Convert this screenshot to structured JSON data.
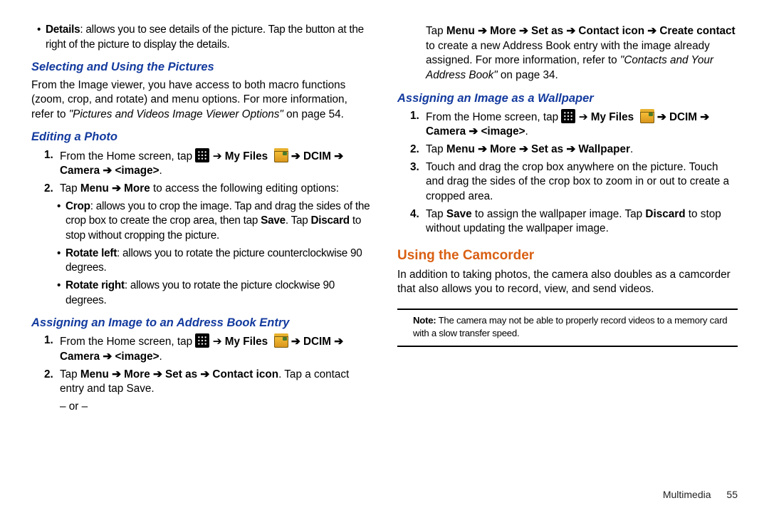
{
  "left": {
    "details_bullet": {
      "title": "Details",
      "text": ": allows you to see details of the picture. Tap the button at the right of the picture to display the details."
    },
    "selecting_head": "Selecting and Using the Pictures",
    "selecting_para_a": "From the Image viewer, you have access to both macro functions (zoom, crop, and rotate) and menu options. For more information, refer to ",
    "selecting_para_ref": "\"Pictures and Videos Image Viewer Options\"",
    "selecting_para_b": "  on page 54.",
    "editing_head": "Editing a Photo",
    "edit_step1_a": "From the Home screen, tap ",
    "edit_step1_b": " ➔ ",
    "edit_step1_myfiles": "My Files",
    "edit_step1_dcim": " ➔  DCIM ➔ Camera ➔ <image>",
    "edit_step1_dot": ".",
    "edit_step2_a": "Tap ",
    "edit_step2_b": "Menu ➔ More",
    "edit_step2_c": " to access the following editing options:",
    "crop_title": "Crop",
    "crop_text": ": allows you to crop the image. Tap and drag the sides of the crop box to create the crop area, then tap ",
    "crop_save": "Save",
    "crop_mid": ". Tap ",
    "crop_discard": "Discard",
    "crop_end": " to stop without cropping the picture.",
    "rotl_title": "Rotate left",
    "rotl_text": ": allows you to rotate the picture counterclockwise 90 degrees.",
    "rotr_title": "Rotate right",
    "rotr_text": ": allows you to rotate the picture clockwise 90 degrees.",
    "assign_ab_head": "Assigning an Image to an Address Book Entry",
    "ab_step1_a": "From the Home screen, tap ",
    "ab_step1_myfiles": "My Files",
    "ab_step1_dcim": " ➔  DCIM ➔ Camera ➔ <image>",
    "ab_step1_dot": ".",
    "ab_step2_a": "Tap ",
    "ab_step2_b": "Menu ➔ More ➔ Set as ➔ Contact icon",
    "ab_step2_c": ". Tap a contact entry and tap Save.",
    "or_text": "– or –"
  },
  "right": {
    "top_a": "Tap ",
    "top_b": "Menu ➔ More ➔ Set as ➔ Contact icon ➔ Create contact",
    "top_c": " to create a new Address Book entry with the image already assigned. For more information, refer to ",
    "top_ref": "\"Contacts and Your Address Book\"",
    "top_d": "  on page 34.",
    "wall_head": "Assigning an Image as a Wallpaper",
    "w_step1_a": "From the Home screen, tap ",
    "w_step1_myfiles": "My Files",
    "w_step1_dcim": " ➔  DCIM ➔ Camera ➔ <image>",
    "w_step1_dot": ".",
    "w_step2_a": "Tap ",
    "w_step2_b": "Menu ➔ More ➔ Set as ➔ Wallpaper",
    "w_step2_dot": ".",
    "w_step3": "Touch and drag the crop box anywhere on the picture. Touch and drag the sides of the crop box to zoom in or out to create a cropped area.",
    "w_step4_a": "Tap ",
    "w_step4_save": "Save",
    "w_step4_b": " to assign the wallpaper image. Tap ",
    "w_step4_discard": "Discard",
    "w_step4_c": " to stop without updating the wallpaper image.",
    "cam_head": "Using the Camcorder",
    "cam_para": "In addition to taking photos, the camera also doubles as a camcorder that also allows you to record, view, and send videos.",
    "note_label": "Note:",
    "note_text": " The camera may not be able to properly record videos to a memory card with a slow transfer speed."
  },
  "footer": {
    "section": "Multimedia",
    "page": "55"
  }
}
